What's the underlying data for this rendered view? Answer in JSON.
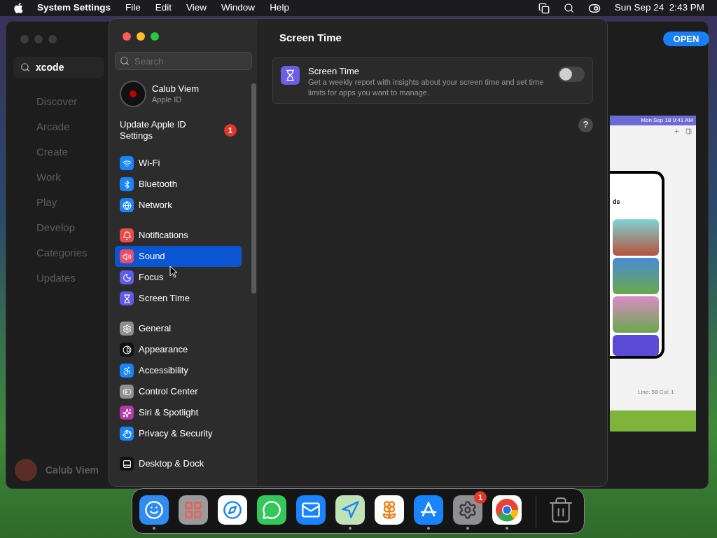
{
  "menubar": {
    "app_name": "System Settings",
    "menus": [
      "File",
      "Edit",
      "View",
      "Window",
      "Help"
    ],
    "clock": "Sun Sep 24  2:43 PM"
  },
  "app_store": {
    "search_value": "xcode",
    "nav": [
      "Discover",
      "Arcade",
      "Create",
      "Work",
      "Play",
      "Develop",
      "Categories",
      "Updates"
    ],
    "user": "Calub Viem",
    "open_button": "OPEN",
    "preview": {
      "status_text": "Mon Sep 18 9:41 AM",
      "heading": "ds",
      "status_line": "Line: 58  Col: 1"
    }
  },
  "settings": {
    "search": {
      "placeholder": "Search"
    },
    "account": {
      "name": "Calub Viem",
      "subtitle": "Apple ID"
    },
    "update": {
      "label": "Update Apple ID Settings",
      "badge": "1"
    },
    "groups": [
      [
        {
          "kind": "wifi",
          "label": "Wi-Fi",
          "color": "#1a84ff",
          "selected": false
        },
        {
          "kind": "bluetooth",
          "label": "Bluetooth",
          "color": "#1a84ff",
          "selected": false
        },
        {
          "kind": "network",
          "label": "Network",
          "color": "#1a84ff",
          "selected": false
        }
      ],
      [
        {
          "kind": "notifications",
          "label": "Notifications",
          "color": "#ec4b4b",
          "selected": false
        },
        {
          "kind": "sound",
          "label": "Sound",
          "color": "#ec4b6a",
          "selected": true
        },
        {
          "kind": "focus",
          "label": "Focus",
          "color": "#5e5ce6",
          "selected": false
        },
        {
          "kind": "screentime",
          "label": "Screen Time",
          "color": "#5e5ce6",
          "selected": false
        }
      ],
      [
        {
          "kind": "general",
          "label": "General",
          "color": "#8e8e93",
          "selected": false
        },
        {
          "kind": "appearance",
          "label": "Appearance",
          "color": "#111111",
          "selected": false
        },
        {
          "kind": "accessibility",
          "label": "Accessibility",
          "color": "#1a84ff",
          "selected": false
        },
        {
          "kind": "controlcenter",
          "label": "Control Center",
          "color": "#8e8e93",
          "selected": false
        },
        {
          "kind": "siri",
          "label": "Siri & Spotlight",
          "color": "#b03aa8",
          "selected": false
        },
        {
          "kind": "privacy",
          "label": "Privacy & Security",
          "color": "#1a84ff",
          "selected": false
        }
      ],
      [
        {
          "kind": "desktop",
          "label": "Desktop & Dock",
          "color": "#111111",
          "selected": false
        }
      ]
    ],
    "content": {
      "title": "Screen Time",
      "card": {
        "title": "Screen Time",
        "description": "Get a weekly report with insights about your screen time and set time limits for apps you want to manage.",
        "on": false
      },
      "help": "?"
    }
  },
  "dock": {
    "items": [
      {
        "kind": "finder",
        "running": true
      },
      {
        "kind": "launchpad",
        "running": false
      },
      {
        "kind": "safari",
        "running": false
      },
      {
        "kind": "messages",
        "running": false
      },
      {
        "kind": "mail",
        "running": false
      },
      {
        "kind": "maps",
        "running": true
      },
      {
        "kind": "photos",
        "running": false
      },
      {
        "kind": "appstore",
        "running": true
      },
      {
        "kind": "settings",
        "running": true,
        "badge": "1"
      },
      {
        "kind": "chrome",
        "running": true
      },
      {
        "kind": "trash",
        "running": false
      }
    ]
  }
}
